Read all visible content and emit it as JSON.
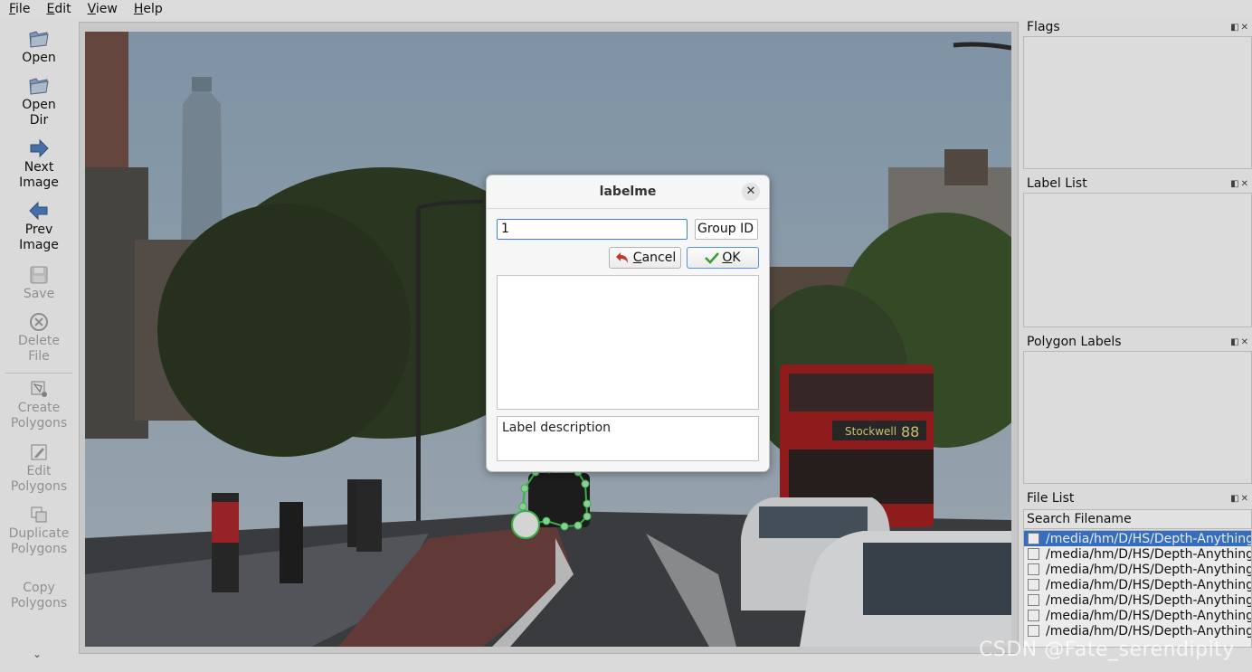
{
  "menubar": {
    "file": {
      "underline": "F",
      "rest": "ile"
    },
    "edit": {
      "underline": "E",
      "rest": "dit"
    },
    "view": {
      "underline": "V",
      "rest": "iew"
    },
    "help": {
      "underline": "H",
      "rest": "elp"
    }
  },
  "toolbar": {
    "open": "Open",
    "open_dir": "Open\nDir",
    "next_image": "Next\nImage",
    "prev_image": "Prev\nImage",
    "save": "Save",
    "delete_file": "Delete\nFile",
    "create_polygons": "Create\nPolygons",
    "edit_polygons": "Edit\nPolygons",
    "duplicate_polygons": "Duplicate\nPolygons",
    "copy_polygons": "Copy\nPolygons"
  },
  "docks": {
    "flags": "Flags",
    "label_list": "Label List",
    "polygon_labels": "Polygon Labels",
    "file_list": "File List",
    "search_placeholder": "Search Filename",
    "files": [
      "/media/hm/D/HS/Depth-Anything",
      "/media/hm/D/HS/Depth-Anything",
      "/media/hm/D/HS/Depth-Anything",
      "/media/hm/D/HS/Depth-Anything",
      "/media/hm/D/HS/Depth-Anything",
      "/media/hm/D/HS/Depth-Anything",
      "/media/hm/D/HS/Depth-Anything"
    ]
  },
  "dialog": {
    "title": "labelme",
    "label_value": "1",
    "group_id_placeholder": "Group ID",
    "cancel": {
      "underline": "C",
      "rest": "ancel"
    },
    "ok": {
      "underline": "O",
      "rest": "K"
    },
    "description_placeholder": "Label description"
  },
  "canvas": {
    "bus_destination": "Stockwell",
    "bus_route": "88"
  },
  "watermark": "CSDN @Fate_serendipity"
}
